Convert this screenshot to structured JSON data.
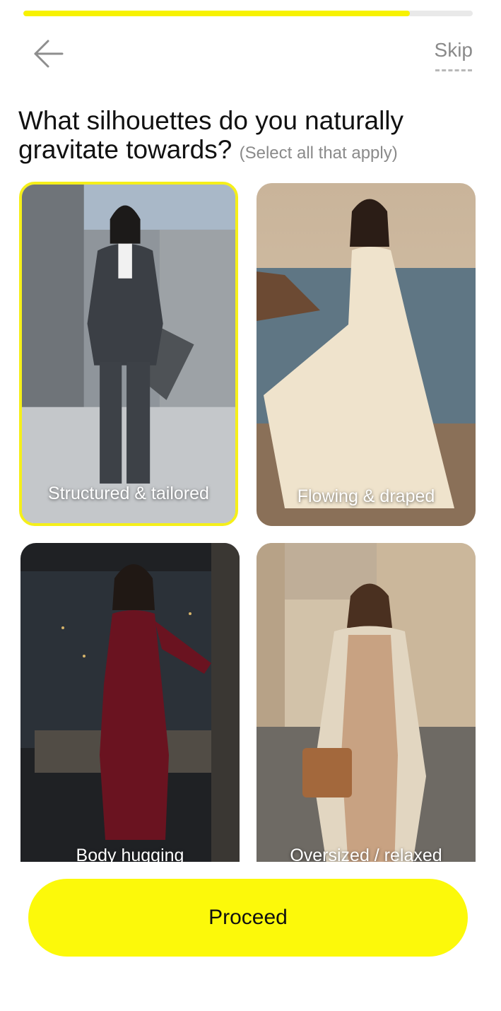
{
  "progress": {
    "fraction": 0.86,
    "track_color": "#e9e9e9",
    "fill_color": "#f7f200"
  },
  "header": {
    "back_icon": "arrow-left-icon",
    "skip_label": "Skip"
  },
  "question": {
    "title": "What silhouettes do you naturally gravitate towards?",
    "hint": "(Select all that apply)"
  },
  "options": [
    {
      "label": "Structured & tailored",
      "selected": true
    },
    {
      "label": "Flowing & draped",
      "selected": false
    },
    {
      "label": "Body hugging",
      "selected": false
    },
    {
      "label": "Oversized / relaxed",
      "selected": false
    }
  ],
  "proceed_label": "Proceed",
  "colors": {
    "accent": "#fcf90a",
    "selection_border": "#f5ef1a"
  }
}
